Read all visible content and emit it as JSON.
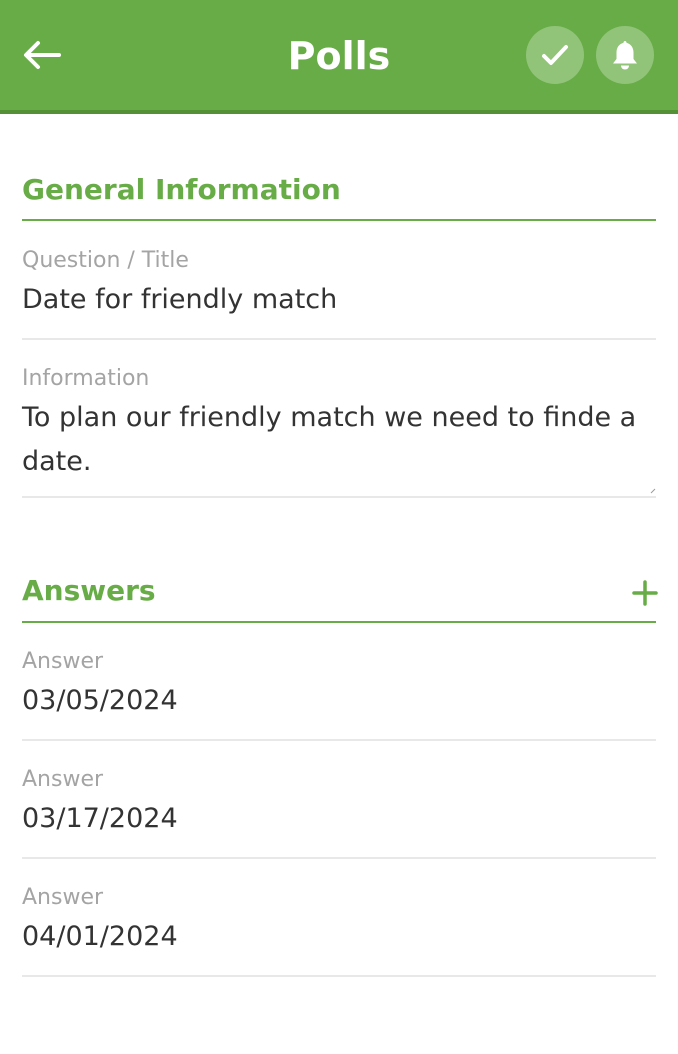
{
  "header": {
    "title": "Polls",
    "back_icon": "arrow-left-icon",
    "save_icon": "checkmark-icon",
    "notify_icon": "bell-icon",
    "bar_color": "#67ac46"
  },
  "general": {
    "heading": "General Information",
    "question_label": "Question / Title",
    "question_value": "Date for friendly match",
    "info_label": "Information",
    "info_value": "To plan our friendly match we need to finde a date."
  },
  "answers": {
    "heading": "Answers",
    "add_icon": "plus-icon",
    "items": [
      {
        "label": "Answer",
        "value": "03/05/2024"
      },
      {
        "label": "Answer",
        "value": "03/17/2024"
      },
      {
        "label": "Answer",
        "value": "04/01/2024"
      }
    ]
  },
  "colors": {
    "accent": "#67ac46",
    "label": "#a4a4a4",
    "text": "#333333",
    "divider": "#e8e8e8"
  }
}
